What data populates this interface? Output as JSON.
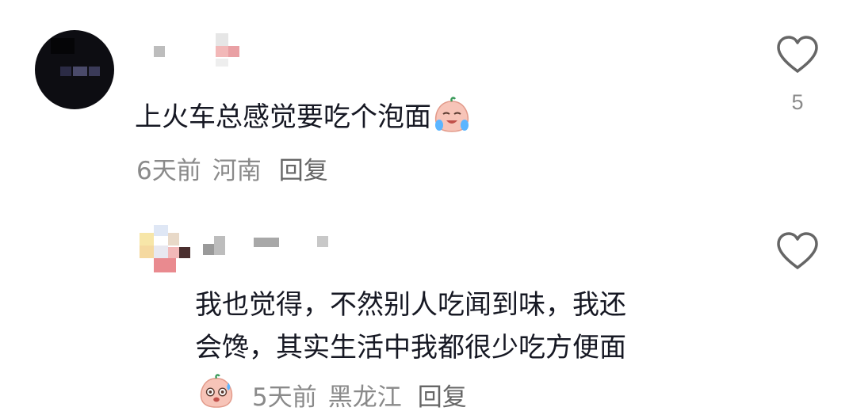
{
  "comments": [
    {
      "text": "上火车总感觉要吃个泡面",
      "emoji": "crying-peach-emoji",
      "time": "6天前",
      "location": "河南",
      "reply_label": "回复",
      "like_count": "5"
    },
    {
      "text_line1": "我也觉得，不然别人吃闻到味，我还",
      "text_line2": "会馋，其实生活中我都很少吃方便面",
      "emoji": "sweating-peach-emoji",
      "time": "5天前",
      "location": "黑龙江",
      "reply_label": "回复"
    }
  ],
  "colors": {
    "text": "#161823",
    "meta": "#8a8a8a",
    "heart": "#666666"
  },
  "icons": {
    "like": "heart-outline-icon"
  }
}
